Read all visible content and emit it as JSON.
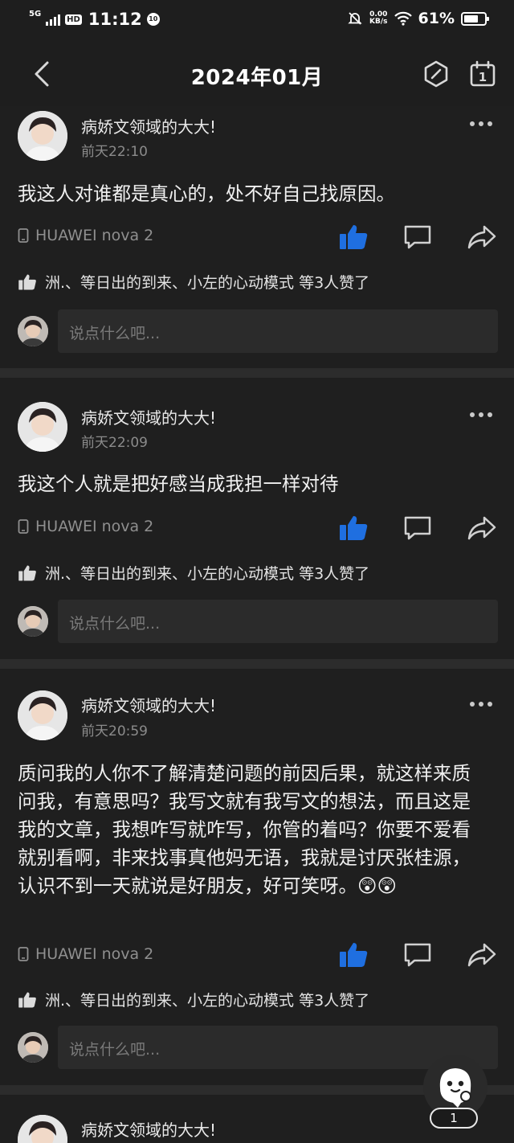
{
  "status_bar": {
    "network": "5G",
    "hd": "HD",
    "time": "11:12",
    "badge": "10",
    "speed_value": "0.00",
    "speed_unit": "KB/s",
    "battery": "61%"
  },
  "header": {
    "title": "2024年01月",
    "calendar_day": "1"
  },
  "posts": [
    {
      "author": "病娇文领域的大大!",
      "time": "前天22:10",
      "content": "我这人对谁都是真心的，处不好自己找原因。",
      "device": "HUAWEI nova 2",
      "likes_text": "洲.、等日出的到来、小左的心动模式 等3人赞了",
      "comment_placeholder": "说点什么吧..."
    },
    {
      "author": "病娇文领域的大大!",
      "time": "前天22:09",
      "content": "我这个人就是把好感当成我担一样对待",
      "device": "HUAWEI nova 2",
      "likes_text": "洲.、等日出的到来、小左的心动模式 等3人赞了",
      "comment_placeholder": "说点什么吧..."
    },
    {
      "author": "病娇文领域的大大!",
      "time": "前天20:59",
      "content": "质问我的人你不了解清楚问题的前因后果，就这样来质问我，有意思吗？我写文就有我写文的想法，而且这是我的文章，我想咋写就咋写，你管的着吗？你要不爱看就别看啊，非来找事真他妈无语，我就是讨厌张桂源，认识不到一天就说是好朋友，好可笑呀。😲😲",
      "device": "HUAWEI nova 2",
      "likes_text": "洲.、等日出的到来、小左的心动模式 等3人赞了",
      "comment_placeholder": "说点什么吧..."
    },
    {
      "author": "病娇文领域的大大!"
    }
  ],
  "float_button": {
    "count": "1"
  },
  "colors": {
    "like_active": "#1f6fe0",
    "background": "#1f1f1f",
    "divider": "#2c2c2c"
  },
  "icons": [
    "back-arrow-icon",
    "hexagon-icon",
    "calendar-icon",
    "phone-icon",
    "thumbs-up-icon",
    "comment-icon",
    "share-icon",
    "ghost-mascot-icon"
  ]
}
